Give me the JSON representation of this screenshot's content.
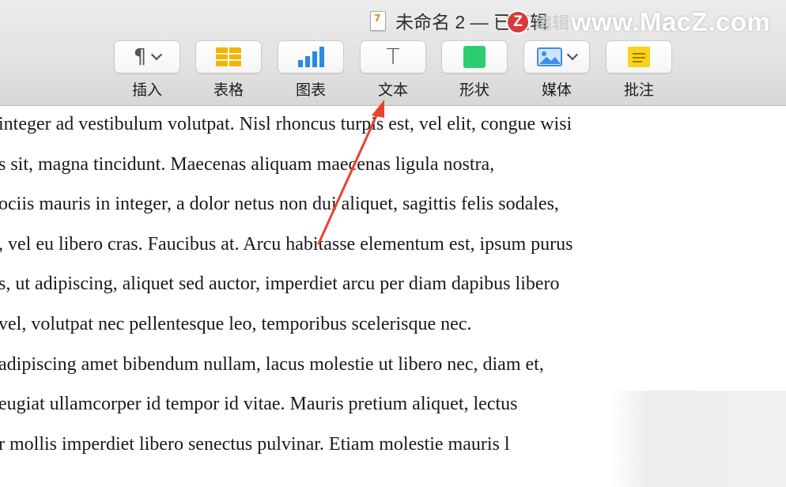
{
  "window": {
    "title": "未命名 2 — 已编辑",
    "doc_icon_glyph": "7"
  },
  "watermark": {
    "badge": "Z",
    "faded": "编辑",
    "text": "www.MacZ.com"
  },
  "toolbar": {
    "items": [
      {
        "label": "插入",
        "icon": "paragraph-icon"
      },
      {
        "label": "表格",
        "icon": "table-icon"
      },
      {
        "label": "图表",
        "icon": "chart-icon"
      },
      {
        "label": "文本",
        "icon": "text-icon"
      },
      {
        "label": "形状",
        "icon": "shape-icon"
      },
      {
        "label": "媒体",
        "icon": "media-icon"
      },
      {
        "label": "批注",
        "icon": "comment-icon"
      }
    ],
    "paragraph_glyph": "¶",
    "text_glyph": "T"
  },
  "document": {
    "lines": [
      "integer ad vestibulum volutpat. Nisl rhoncus turpis est, vel elit, congue wisi",
      "s sit, magna tincidunt. Maecenas aliquam maecenas ligula nostra,",
      "ociis mauris in integer, a dolor netus non dui aliquet, sagittis felis sodales,",
      ", vel eu libero cras. Faucibus at. Arcu habitasse elementum est, ipsum purus",
      "s, ut adipiscing, aliquet sed auctor, imperdiet arcu per diam dapibus libero",
      " vel, volutpat nec pellentesque leo, temporibus scelerisque nec.",
      "adipiscing amet bibendum nullam, lacus molestie ut libero nec, diam et,",
      "eugiat ullamcorper id tempor id vitae. Mauris pretium aliquet, lectus",
      "r mollis imperdiet libero senectus pulvinar. Etiam molestie mauris l"
    ]
  },
  "colors": {
    "table_icon": "#f5b400",
    "chart_icon": "#2a8ae0",
    "shape_icon": "#2ecc71",
    "comment_icon": "#f8d21c",
    "media_icon": "#3b8fe6",
    "arrow": "#e8432e"
  }
}
